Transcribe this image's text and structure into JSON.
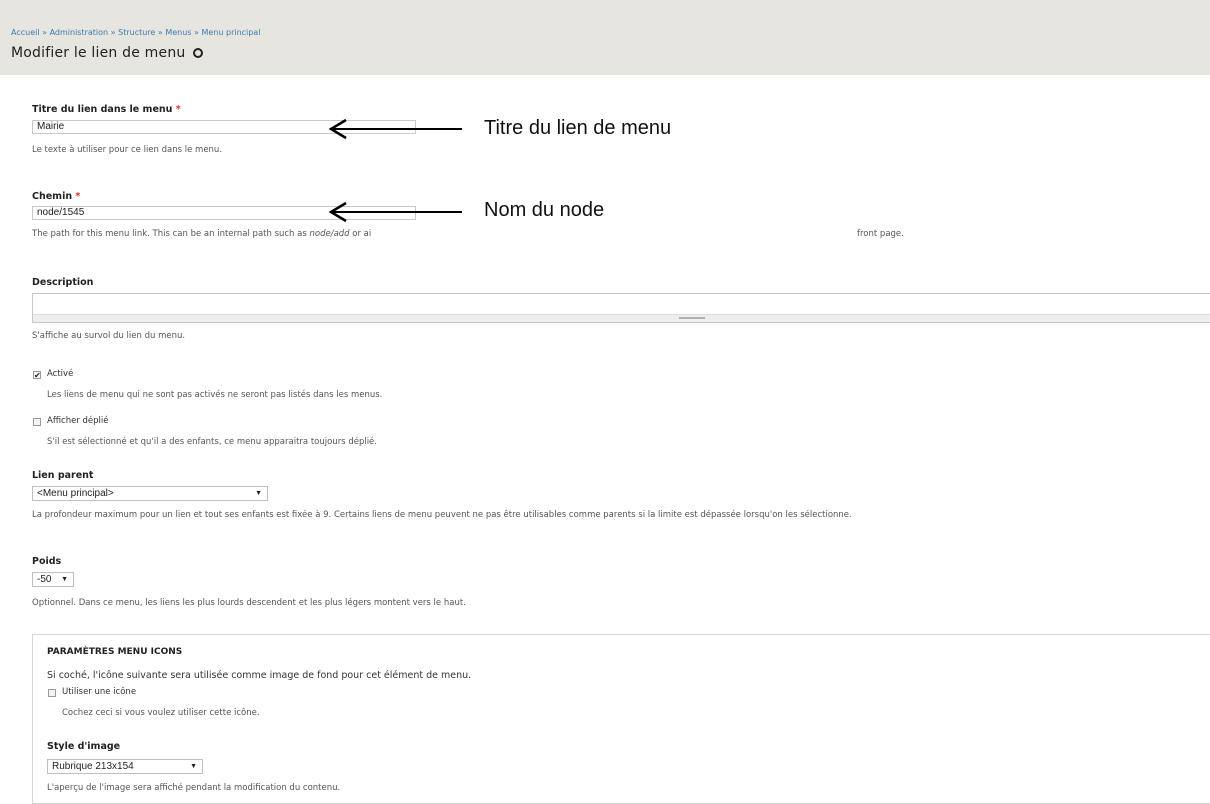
{
  "breadcrumb": [
    "Accueil",
    "Administration",
    "Structure",
    "Menus",
    "Menu principal"
  ],
  "breadcrumb_separator": "»",
  "page_title": "Modifier le lien de menu",
  "form": {
    "title_field": {
      "label": "Titre du lien dans le menu",
      "required_mark": "*",
      "value": "Mairie",
      "description": "Le texte à utiliser pour ce lien dans le menu."
    },
    "path_field": {
      "label": "Chemin",
      "required_mark": "*",
      "value": "node/1545",
      "description_start": "The path for this menu link. This can be an internal path such as",
      "description_em": "node/add",
      "description_mid": "or ai",
      "description_end": "front page."
    },
    "description_field": {
      "label": "Description",
      "value": "",
      "description": "S'affiche au survol du lien du menu."
    },
    "enabled": {
      "label": "Activé",
      "checked": true,
      "check_glyph": "✔",
      "description": "Les liens de menu qui ne sont pas activés ne seront pas listés dans les menus."
    },
    "expanded": {
      "label": "Afficher déplié",
      "checked": false,
      "description": "S'il est sélectionné et qu'il a des enfants, ce menu apparaitra toujours déplié."
    },
    "parent": {
      "label": "Lien parent",
      "selected": "<Menu principal>",
      "description": "La profondeur maximum pour un lien et tout ses enfants est fixée à 9. Certains liens de menu peuvent ne pas être utilisables comme parents si la limite est dépassée lorsqu'on les sélectionne."
    },
    "weight": {
      "label": "Poids",
      "selected": "-50",
      "description": "Optionnel. Dans ce menu, les liens les plus lourds descendent et les plus légers montent vers le haut."
    },
    "menu_icons": {
      "legend": "PARAMÈTRES MENU ICONS",
      "intro": "Si coché, l'icône suivante sera utilisée comme image de fond pour cet élément de menu.",
      "use_icon_label": "Utiliser une icône",
      "use_icon_checked": false,
      "use_icon_description": "Cochez ceci si vous voulez utiliser cette icône.",
      "image_style_label": "Style d'image",
      "image_style_selected": "Rubrique 213x154",
      "image_style_description": "L'aperçu de l'image sera affiché pendant la modification du contenu."
    }
  },
  "annotations": {
    "title_note": "Titre du lien de menu",
    "path_note": "Nom du node"
  },
  "caret_glyph": "▼",
  "colors": {
    "header_bg": "#e6e5df",
    "link": "#3d7bb0",
    "required": "#e0301e"
  }
}
